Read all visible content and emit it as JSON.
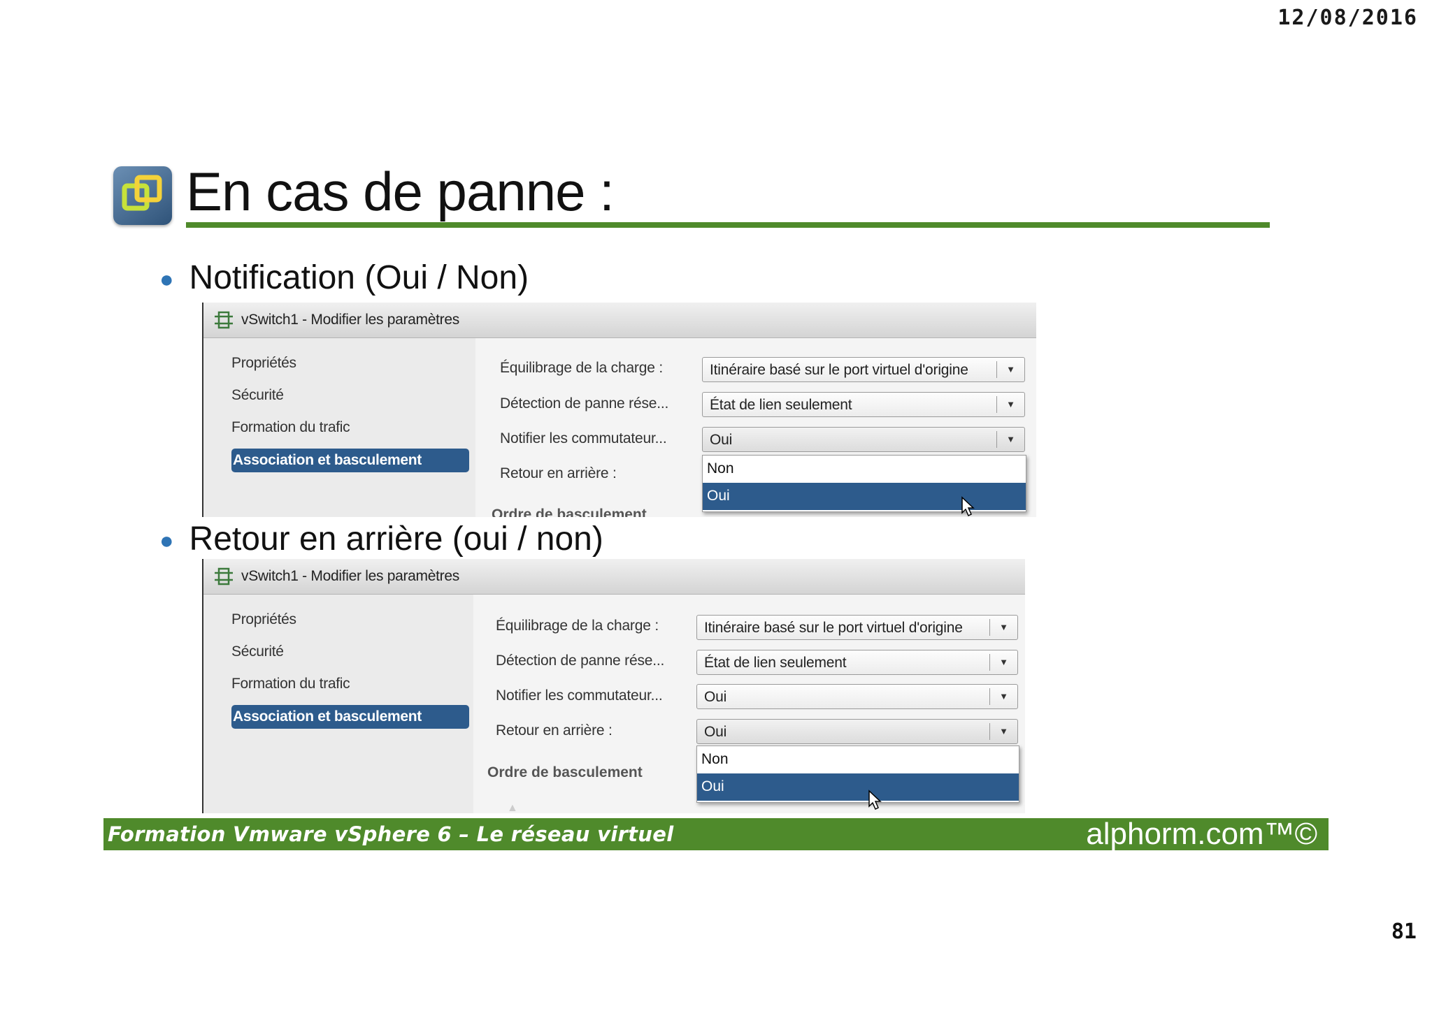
{
  "date": "12/08/2016",
  "page_number": "81",
  "title": "En cas de panne :",
  "bullets": [
    "Notification (Oui / Non)",
    "Retour en arrière (oui / non)"
  ],
  "dialog": {
    "title": "vSwitch1 - Modifier les paramètres",
    "nav": [
      "Propriétés",
      "Sécurité",
      "Formation du trafic",
      "Association et basculement"
    ],
    "labels": {
      "load_balancing": "Équilibrage de la charge :",
      "failure_detection": "Détection de panne rése...",
      "notify_switches": "Notifier les commutateur...",
      "failback": "Retour en arrière :"
    },
    "values": {
      "load_balancing": "Itinéraire basé sur le port virtuel d'origine",
      "failure_detection": "État de lien seulement",
      "notify_switches": "Oui",
      "failback": "Oui"
    },
    "dropdown_options": [
      "Non",
      "Oui"
    ],
    "failover_order_heading": "Ordre de basculement",
    "failover_order_heading_cut": "Ordre de basculement"
  },
  "footer": {
    "course": "Formation Vmware vSphere 6 – Le réseau virtuel",
    "brand": "alphorm.com™©"
  }
}
